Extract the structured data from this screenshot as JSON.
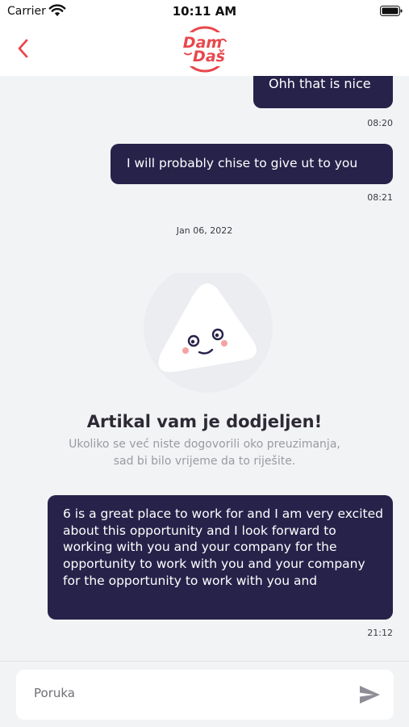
{
  "status_bar": {
    "carrier": "Carrier",
    "time": "10:11 AM"
  },
  "header": {
    "logo_line1": "Dam",
    "logo_line2": "Daš",
    "brand_color": "#e8474c"
  },
  "messages": [
    {
      "text": "Ohh that is nice",
      "time": "08:20"
    },
    {
      "text": "I will probably chise to give ut to you",
      "time": "08:21"
    },
    {
      "text": "6 is a great place to work for and I am very excited about this opportunity and I look forward to working with you and your company for the opportunity to work with you and your company for the opportunity to work with you and",
      "time": "21:12"
    }
  ],
  "date_separator": "Jan 06, 2022",
  "notice": {
    "title": "Artikal vam je dodjeljen!",
    "line1": "Ukoliko se već niste dogovorili oko preuzimanja,",
    "line2": "sad bi bilo vrijeme da to riješite."
  },
  "composer": {
    "placeholder": "Poruka"
  },
  "colors": {
    "bubble": "#27224a",
    "accent": "#e8474c",
    "background": "#f2f3f5"
  }
}
